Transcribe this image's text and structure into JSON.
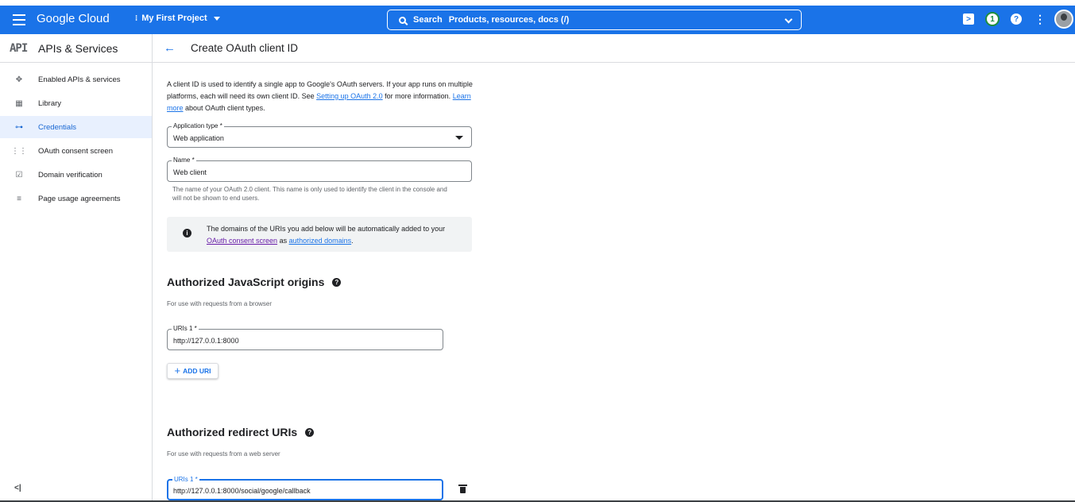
{
  "topbar": {
    "logo": "Google Cloud",
    "project": "My First Project",
    "search_label": "Search",
    "search_placeholder": "Products, resources, docs (/)",
    "notifications_count": "1"
  },
  "sidebar": {
    "badge": "API",
    "title": "APIs & Services",
    "items": [
      {
        "label": "Enabled APIs & services",
        "icon": "hub-icon"
      },
      {
        "label": "Library",
        "icon": "library-icon"
      },
      {
        "label": "Credentials",
        "icon": "key-icon",
        "active": true
      },
      {
        "label": "OAuth consent screen",
        "icon": "consent-icon"
      },
      {
        "label": "Domain verification",
        "icon": "checkbox-icon"
      },
      {
        "label": "Page usage agreements",
        "icon": "settings-list-icon"
      }
    ],
    "collapse_label": "<|"
  },
  "main": {
    "title": "Create OAuth client ID",
    "intro": {
      "part1": "A client ID is used to identify a single app to Google's OAuth servers. If your app runs on multiple platforms, each will need its own client ID. See ",
      "link1": "Setting up OAuth 2.0",
      "part2": " for more information. ",
      "link2": "Learn more",
      "part3": " about OAuth client types."
    },
    "application_type": {
      "label": "Application type *",
      "value": "Web application"
    },
    "name": {
      "label": "Name *",
      "value": "Web client",
      "hint": "The name of your OAuth 2.0 client. This name is only used to identify the client in the console and will not be shown to end users."
    },
    "info": {
      "part1": "The domains of the URIs you add below will be automatically added to your ",
      "link1": "OAuth consent screen",
      "part2": " as ",
      "link2": "authorized domains",
      "part3": "."
    },
    "js_origins": {
      "title": "Authorized JavaScript origins",
      "subtitle": "For use with requests from a browser",
      "uri_label": "URIs 1 *",
      "uri_value": "http://127.0.0.1:8000",
      "add_label": "ADD URI"
    },
    "redirect": {
      "title": "Authorized redirect URIs",
      "subtitle": "For use with requests from a web server",
      "uri_label": "URIs 1 *",
      "uri_value": "http://127.0.0.1:8000/social/google/callback"
    }
  }
}
